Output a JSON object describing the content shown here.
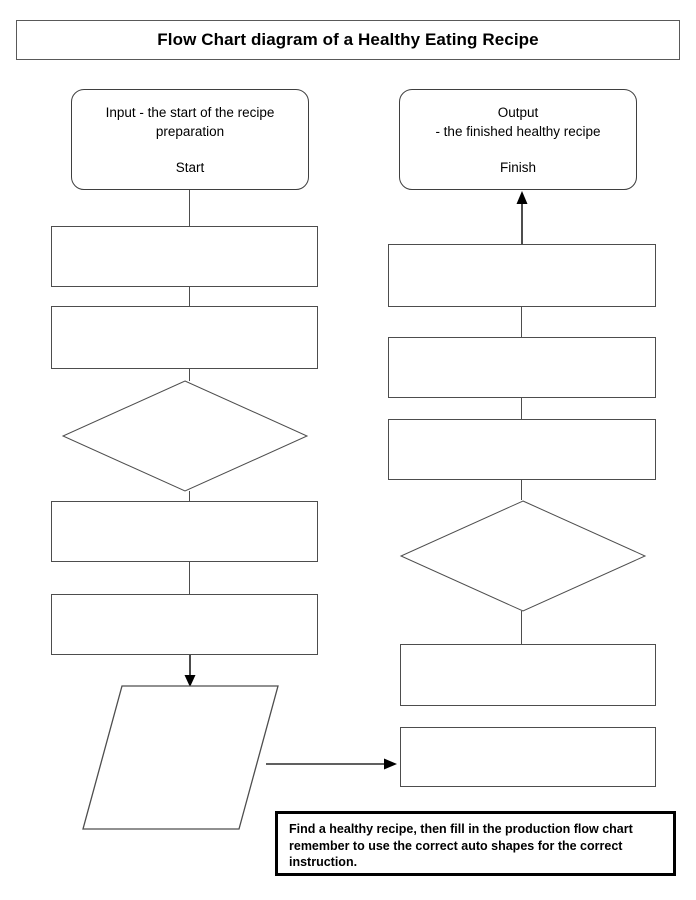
{
  "title": {
    "text": "Flow Chart diagram of a Healthy Eating Recipe"
  },
  "start_terminator": {
    "description": "Input - the start of the recipe preparation",
    "keyword": "Start"
  },
  "end_terminator": {
    "description": "Output\n- the finished healthy recipe",
    "keyword": "Finish"
  },
  "left_column": {
    "shapes": [
      {
        "type": "process",
        "label": ""
      },
      {
        "type": "process",
        "label": ""
      },
      {
        "type": "decision",
        "label": ""
      },
      {
        "type": "process",
        "label": ""
      },
      {
        "type": "process",
        "label": ""
      },
      {
        "type": "data",
        "label": ""
      }
    ]
  },
  "right_column": {
    "shapes": [
      {
        "type": "process",
        "label": ""
      },
      {
        "type": "process",
        "label": ""
      },
      {
        "type": "process",
        "label": ""
      },
      {
        "type": "decision",
        "label": ""
      },
      {
        "type": "process",
        "label": ""
      },
      {
        "type": "process",
        "label": ""
      }
    ]
  },
  "instruction_note": {
    "text": "Find a healthy recipe, then fill in the production flow chart remember to use the correct auto shapes for the correct instruction."
  },
  "colors": {
    "shape_stroke": "#4d4d4d",
    "note_stroke": "#000000",
    "arrow": "#000000",
    "background": "#ffffff",
    "text": "#000000"
  }
}
